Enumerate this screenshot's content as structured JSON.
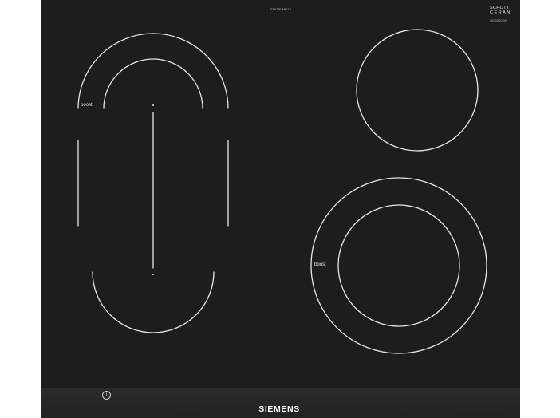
{
  "model_number": "ET675LMP1E",
  "glass_brand": {
    "line1": "SCHOTT",
    "line2": "CERAN",
    "small_text": "9000000000"
  },
  "zones": [
    {
      "label": "boost"
    },
    {
      "label": "boost"
    }
  ],
  "controls": {
    "info_icon": "info-icon",
    "info_glyph": "i"
  },
  "brand": "SIEMENS",
  "colors": {
    "glass": "#1d1d1d",
    "lines": "#e6e6e6"
  }
}
